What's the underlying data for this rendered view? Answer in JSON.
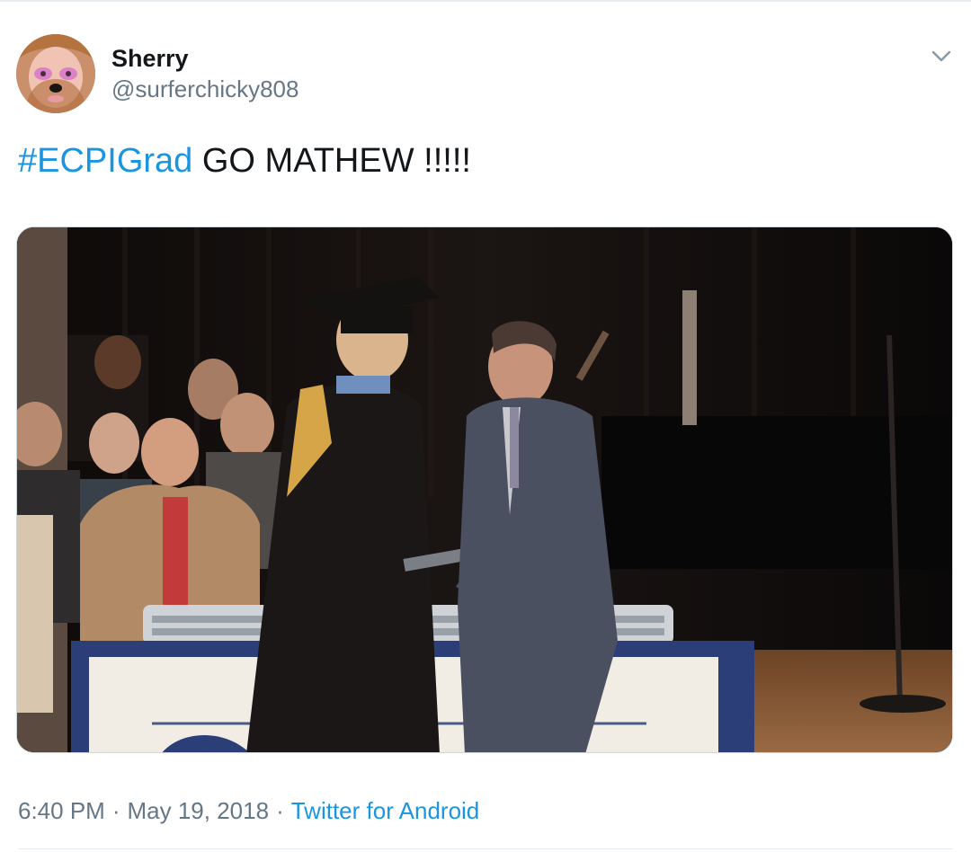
{
  "tweet": {
    "author": {
      "display_name": "Sherry",
      "handle": "@surferchicky808",
      "avatar_icon": "profile-photo"
    },
    "menu_icon": "chevron-down-icon",
    "text": {
      "hashtag": "#ECPIGrad",
      "body": " GO MATHEW !!!!!"
    },
    "media": {
      "kind": "video-still",
      "icon": "graduation-ceremony-photo"
    },
    "meta": {
      "time": "6:40 PM",
      "separator": "·",
      "date": "May 19, 2018",
      "source": "Twitter for Android"
    }
  },
  "colors": {
    "link": "#1b95e0",
    "text": "#14171a",
    "secondary": "#657786",
    "divider": "#e6ecf0"
  }
}
